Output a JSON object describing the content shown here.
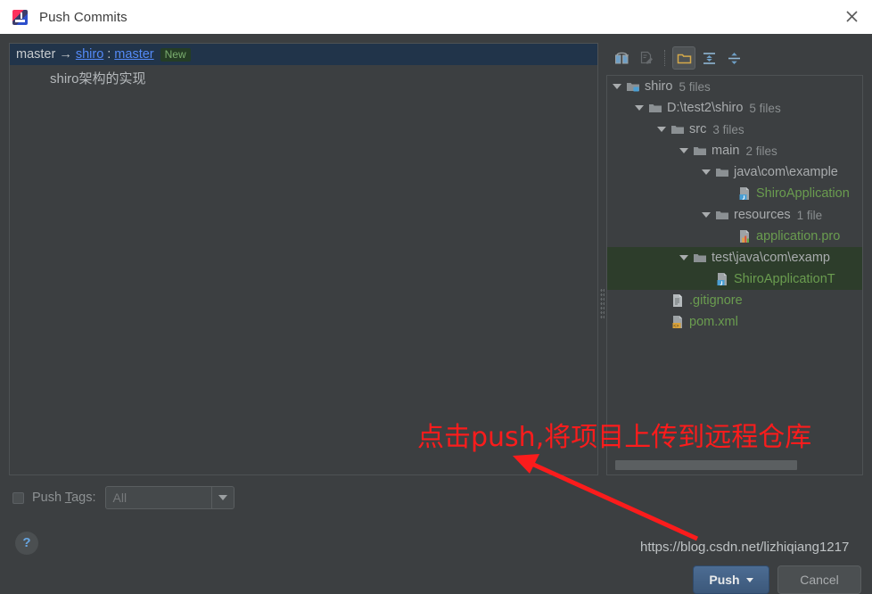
{
  "window": {
    "title": "Push Commits",
    "app_icon": "intellij-idea-icon",
    "close_label": "✕"
  },
  "commits": {
    "branch_row": {
      "local_branch": "master",
      "arrow": "→",
      "remote": "shiro",
      "separator": ":",
      "remote_branch": "master",
      "badge": "New"
    },
    "items": [
      {
        "message": "shiro架构的实现"
      }
    ]
  },
  "tree_toolbar": {
    "buttons": [
      {
        "name": "revert-icon",
        "title": "Revert",
        "state": "enabled"
      },
      {
        "name": "edit-source-icon",
        "title": "Edit Source",
        "state": "disabled"
      },
      {
        "name": "group-by-directory-icon",
        "title": "Group By Directory",
        "state": "toggled"
      },
      {
        "name": "expand-all-icon",
        "title": "Expand All",
        "state": "enabled"
      },
      {
        "name": "collapse-all-icon",
        "title": "Collapse All",
        "state": "enabled"
      }
    ]
  },
  "tree": {
    "rows": [
      {
        "indent": 0,
        "expander": "expanded",
        "icon": "module-folder-icon",
        "label": "shiro",
        "count": "5 files",
        "color": "grey",
        "selected": false
      },
      {
        "indent": 1,
        "expander": "expanded",
        "icon": "folder-icon",
        "label": "D:\\test2\\shiro",
        "count": "5 files",
        "color": "grey",
        "selected": false
      },
      {
        "indent": 2,
        "expander": "expanded",
        "icon": "folder-icon",
        "label": "src",
        "count": "3 files",
        "color": "grey",
        "selected": false
      },
      {
        "indent": 3,
        "expander": "expanded",
        "icon": "folder-icon",
        "label": "main",
        "count": "2 files",
        "color": "grey",
        "selected": false
      },
      {
        "indent": 4,
        "expander": "expanded",
        "icon": "folder-icon",
        "label": "java\\com\\example",
        "count": "",
        "color": "grey",
        "selected": false
      },
      {
        "indent": 5,
        "expander": "none",
        "icon": "java-file-icon",
        "label": "ShiroApplication",
        "count": "",
        "color": "green",
        "selected": false
      },
      {
        "indent": 4,
        "expander": "expanded",
        "icon": "folder-icon",
        "label": "resources",
        "count": "1 file",
        "color": "grey",
        "selected": false
      },
      {
        "indent": 5,
        "expander": "none",
        "icon": "properties-file-icon",
        "label": "application.pro",
        "count": "",
        "color": "green",
        "selected": false
      },
      {
        "indent": 3,
        "expander": "expanded",
        "icon": "folder-icon",
        "label": "test\\java\\com\\examp",
        "count": "",
        "color": "grey",
        "selected": true
      },
      {
        "indent": 4,
        "expander": "none",
        "icon": "java-file-icon",
        "label": "ShiroApplicationT",
        "count": "",
        "color": "green",
        "selected": true
      },
      {
        "indent": 2,
        "expander": "none",
        "icon": "text-file-icon",
        "label": ".gitignore",
        "count": "",
        "color": "green",
        "selected": false
      },
      {
        "indent": 2,
        "expander": "none",
        "icon": "xml-file-icon",
        "label": "pom.xml",
        "count": "",
        "color": "green",
        "selected": false
      }
    ]
  },
  "footer": {
    "push_tags_checkbox_checked": false,
    "push_tags_label_pre": "Push ",
    "push_tags_label_underlined": "T",
    "push_tags_label_post": "ags:",
    "tags_combo_value": "All",
    "tags_combo_placeholder": "All",
    "help_label": "?",
    "push_button_label": "Push",
    "cancel_button_label": "Cancel"
  },
  "annotations": {
    "callout_text": "点击push,将项目上传到远程仓库",
    "callout_color": "#fb1c1c",
    "watermark": "https://blog.csdn.net/lizhiqiang1217"
  }
}
